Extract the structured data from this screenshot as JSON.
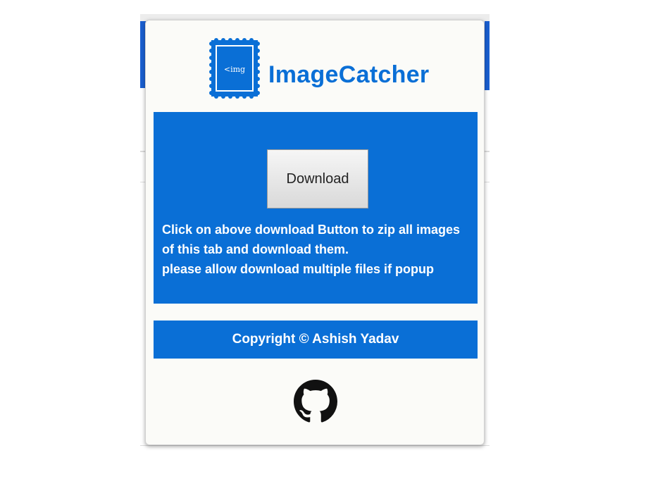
{
  "popup": {
    "logo": {
      "icon": "img-stamp-icon",
      "text": "<img"
    },
    "title": "ImageCatcher",
    "download_button_label": "Download",
    "instructions": [
      "Click on above download Button to zip all images",
      "of this tab and download them.",
      "please allow download multiple files if popup"
    ],
    "copyright": "Copyright © Ashish Yadav",
    "github_icon": "github-icon"
  },
  "colors": {
    "accent": "#0a6fd6",
    "panel_text": "#ffffff",
    "popup_background": "#fbfbf8"
  }
}
